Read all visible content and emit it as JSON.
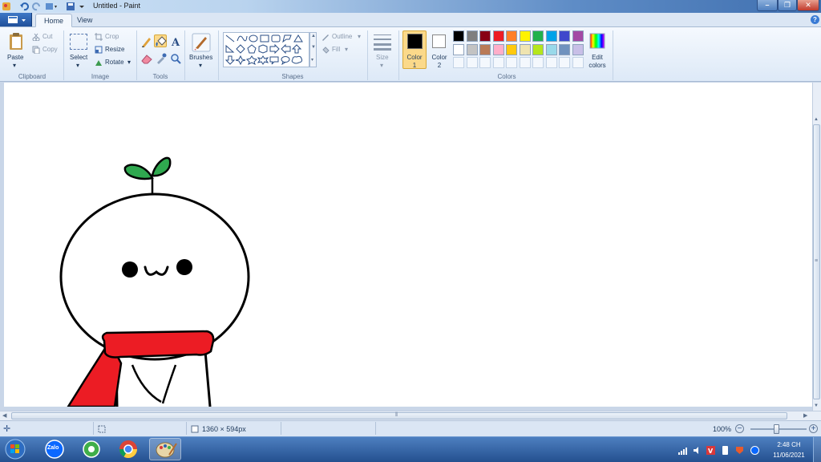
{
  "window": {
    "title": "Untitled - Paint"
  },
  "tabs": [
    {
      "label": "Home",
      "active": true
    },
    {
      "label": "View",
      "active": false
    }
  ],
  "ribbon": {
    "clipboard": {
      "paste": "Paste",
      "cut": "Cut",
      "copy": "Copy",
      "group": "Clipboard"
    },
    "image": {
      "select": "Select",
      "crop": "Crop",
      "resize": "Resize",
      "rotate": "Rotate",
      "group": "Image"
    },
    "tools": {
      "group": "Tools"
    },
    "brushes": {
      "label": "Brushes"
    },
    "shapes": {
      "outline": "Outline",
      "fill": "Fill",
      "group": "Shapes"
    },
    "size": {
      "label": "Size"
    },
    "colors": {
      "color1": "Color 1",
      "color2": "Color 2",
      "edit": "Edit colors",
      "group": "Colors",
      "color1_value": "#000000",
      "color2_value": "#ffffff",
      "palette_row1": [
        "#000000",
        "#7f7f7f",
        "#880015",
        "#ed1c24",
        "#ff7f27",
        "#fff200",
        "#22b14c",
        "#00a2e8",
        "#3f48cc",
        "#a349a4"
      ],
      "palette_row2": [
        "#ffffff",
        "#c3c3c3",
        "#b97a57",
        "#ffaec9",
        "#ffc90e",
        "#efe4b0",
        "#b5e61d",
        "#99d9ea",
        "#7092be",
        "#c8bfe7"
      ]
    }
  },
  "status": {
    "dimensions": "1360 × 594px",
    "zoom": "100%"
  },
  "taskbar": {
    "apps": [
      "start-orb",
      "zalo",
      "zalo-alt",
      "chrome",
      "paint"
    ],
    "zalo_label": "Zalo",
    "clock_time": "2:48 CH",
    "clock_date": "11/06/2021"
  }
}
